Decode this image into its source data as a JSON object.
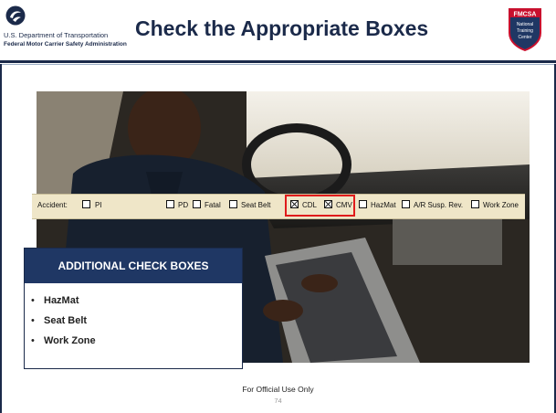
{
  "header": {
    "dept_line": "U.S. Department of Transportation",
    "agency_line": "Federal Motor Carrier Safety Administration",
    "title": "Check the Appropriate Boxes",
    "badge_line1": "FMCSA",
    "badge_line2": "National",
    "badge_line3": "Training",
    "badge_line4": "Center"
  },
  "form_strip": {
    "fields": [
      {
        "label": "Accident:",
        "checked": false
      },
      {
        "label": "PI",
        "checked": false
      },
      {
        "label": "PD",
        "checked": false
      },
      {
        "label": "Fatal",
        "checked": false
      },
      {
        "label": "Seat Belt",
        "checked": false
      },
      {
        "label": "CDL",
        "checked": true
      },
      {
        "label": "CMV",
        "checked": true
      },
      {
        "label": "HazMat",
        "checked": false
      },
      {
        "label": "A/R Susp. Rev.",
        "checked": false
      },
      {
        "label": "Work Zone",
        "checked": false
      }
    ]
  },
  "panel": {
    "heading": "ADDITIONAL CHECK BOXES",
    "items": [
      "HazMat",
      "Seat Belt",
      "Work Zone"
    ],
    "bullet": "•"
  },
  "footer": {
    "notice": "For Official Use Only",
    "page": "74"
  },
  "colors": {
    "navy": "#1f3764",
    "highlight_red": "#e01b1b",
    "strip_bg": "#efe6c8"
  }
}
